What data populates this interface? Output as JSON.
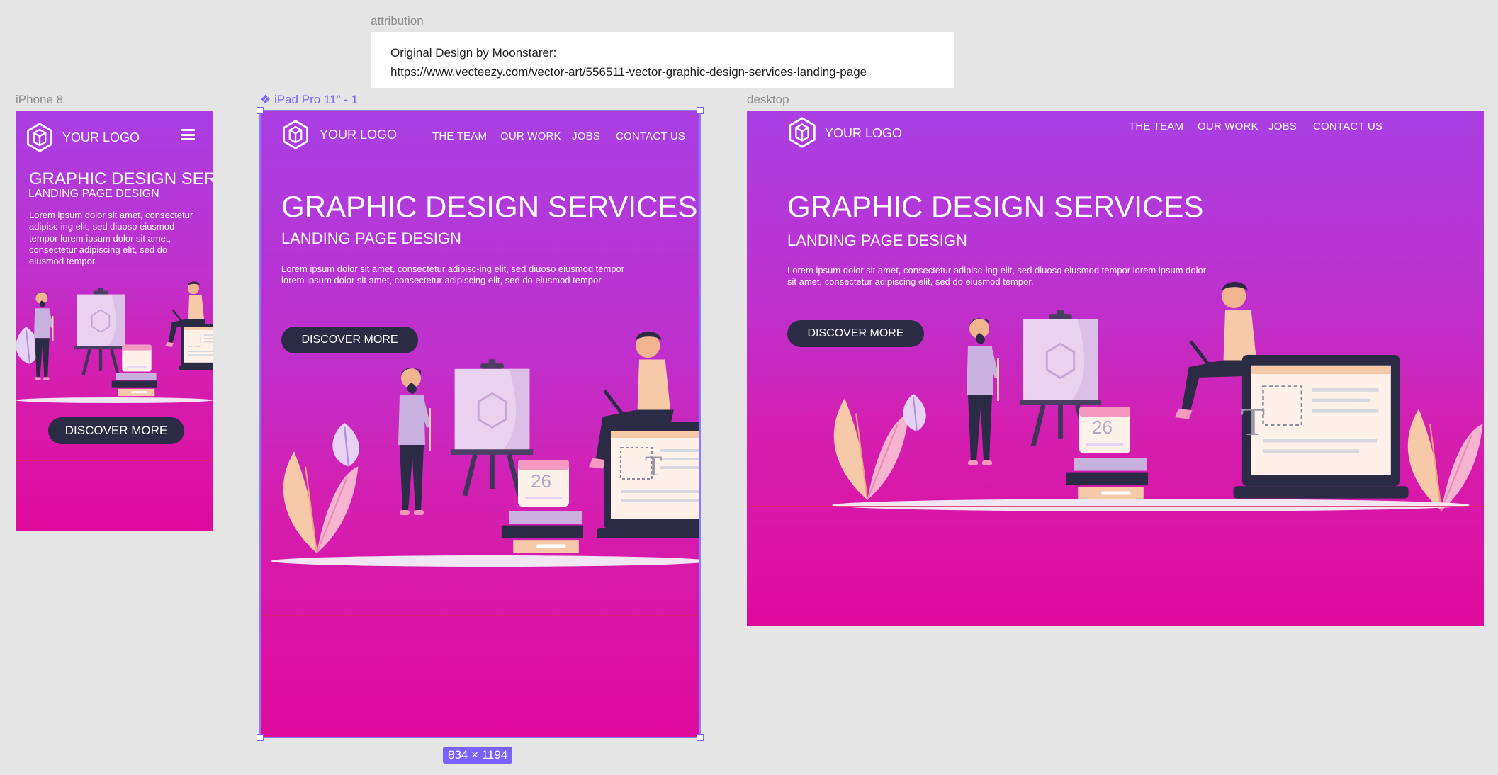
{
  "attribution": {
    "label": "attribution",
    "line1": "Original Design by Moonstarer:",
    "line2": "https://www.vecteezy.com/vector-art/556511-vector-graphic-design-services-landing-page"
  },
  "frames": {
    "phone": {
      "label": "iPhone 8",
      "logo": "YOUR LOGO",
      "title": "GRAPHIC DESIGN SERVICES",
      "subtitle": "LANDING PAGE DESIGN",
      "body": "Lorem ipsum dolor sit amet, consectetur adipisc-ing elit, sed diuoso eiusmod tempor lorem ipsum  dolor sit amet, consectetur adipiscing elit, sed do eiusmod tempor.",
      "cta": "DISCOVER MORE",
      "menu_icon": "hamburger-icon"
    },
    "tablet": {
      "label": "iPad Pro 11\" - 1",
      "component_icon": "component-icon",
      "logo": "YOUR LOGO",
      "nav": [
        "THE TEAM",
        "OUR WORK",
        "JOBS",
        "CONTACT US"
      ],
      "title": "GRAPHIC DESIGN SERVICES",
      "subtitle": "LANDING PAGE DESIGN",
      "body": "Lorem ipsum dolor sit amet, consectetur adipisc-ing elit, sed diuoso eiusmod tempor lorem ipsum  dolor sit amet, consectetur adipiscing elit, sed do eiusmod tempor.",
      "cta": "DISCOVER MORE",
      "calendar_day": "26",
      "doc_letter": "T",
      "size_badge": "834 × 1194"
    },
    "desktop": {
      "label": "desktop",
      "logo": "YOUR LOGO",
      "nav": [
        "THE TEAM",
        "OUR WORK",
        "JOBS",
        "CONTACT US"
      ],
      "title": "GRAPHIC DESIGN SERVICES",
      "subtitle": "LANDING PAGE DESIGN",
      "body": "Lorem ipsum dolor sit amet, consectetur adipisc-ing elit, sed diuoso eiusmod tempor lorem ipsum dolor sit amet, consectetur adipiscing elit, sed do eiusmod tempor.",
      "cta": "DISCOVER MORE",
      "calendar_day": "26",
      "doc_letter": "T"
    }
  },
  "colors": {
    "canvas": "#e5e5e5",
    "gradient_top": "#a93fe3",
    "gradient_bottom": "#df0b9c",
    "button": "#2b2b45",
    "selection": "#7b61ff"
  }
}
